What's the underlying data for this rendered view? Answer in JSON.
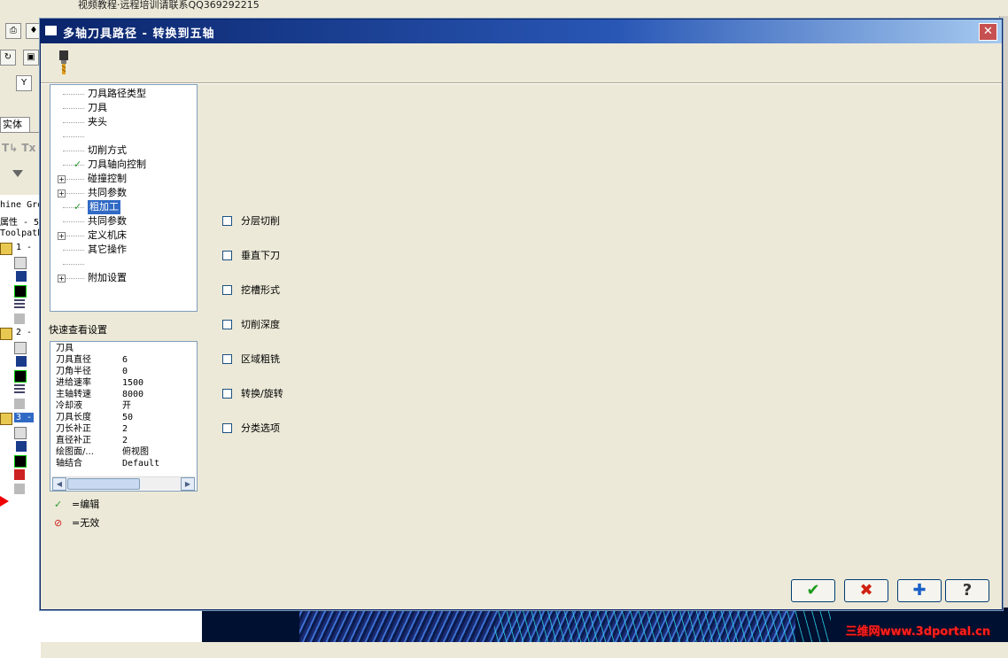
{
  "background": {
    "top_text": "视频教程·远程培训请联系QQ369292215",
    "left_tab": "实体",
    "left_lines": [
      "hine Gro",
      "属性 - 5",
      "Toolpath",
      "1 - ",
      "2 - ",
      "3 - "
    ],
    "watermark": "三维网www.3dportal.cn"
  },
  "dialog": {
    "title": "多轴刀具路径 - 转换到五轴",
    "close_label": "✕",
    "tree_items": [
      {
        "label": "刀具路径类型",
        "check": false,
        "expand": false
      },
      {
        "label": "刀具",
        "check": false,
        "expand": false
      },
      {
        "label": "夹头",
        "check": false,
        "expand": false
      },
      {
        "label": "",
        "check": false,
        "expand": false
      },
      {
        "label": "切削方式",
        "check": false,
        "expand": false
      },
      {
        "label": "刀具轴向控制",
        "check": true,
        "expand": false
      },
      {
        "label": "碰撞控制",
        "check": false,
        "expand": true
      },
      {
        "label": "共同参数",
        "check": false,
        "expand": true
      },
      {
        "label": "粗加工",
        "check": true,
        "expand": false,
        "selected": true
      },
      {
        "label": "共同参数",
        "check": false,
        "expand": false
      },
      {
        "label": "定义机床",
        "check": false,
        "expand": true
      },
      {
        "label": "其它操作",
        "check": false,
        "expand": false
      },
      {
        "label": "",
        "check": false,
        "expand": false
      },
      {
        "label": "附加设置",
        "check": false,
        "expand": true
      }
    ],
    "quick_view_label": "快速查看设置",
    "quick_view": [
      {
        "k": "刀具",
        "v": ""
      },
      {
        "k": "刀具直径",
        "v": "6"
      },
      {
        "k": "刀角半径",
        "v": "0"
      },
      {
        "k": "进给速率",
        "v": "1500"
      },
      {
        "k": "主轴转速",
        "v": "8000"
      },
      {
        "k": "冷却液",
        "v": "开"
      },
      {
        "k": "刀具长度",
        "v": "50"
      },
      {
        "k": "刀长补正",
        "v": "2"
      },
      {
        "k": "直径补正",
        "v": "2"
      },
      {
        "k": "绘图面/...",
        "v": "俯视图"
      },
      {
        "k": "轴结合",
        "v": "Default"
      }
    ],
    "legend": [
      {
        "symbol": "✓",
        "label": "=编辑",
        "color": "#2a9a2a"
      },
      {
        "symbol": "⊘",
        "label": "=无效",
        "color": "#d02020"
      }
    ],
    "options": [
      {
        "label": "分层切削",
        "checked": false
      },
      {
        "label": "垂直下刀",
        "checked": false
      },
      {
        "label": "挖槽形式",
        "checked": false
      },
      {
        "label": "切削深度",
        "checked": false
      },
      {
        "label": "区域粗铣",
        "checked": false
      },
      {
        "label": "转换/旋转",
        "checked": false
      },
      {
        "label": "分类选项",
        "checked": false
      }
    ],
    "buttons": [
      {
        "name": "ok-button",
        "icon": "✔",
        "color": "#1a9a1a"
      },
      {
        "name": "cancel-button",
        "icon": "✖",
        "color": "#d02010"
      },
      {
        "name": "add-button",
        "icon": "✚",
        "color": "#1a60c8"
      },
      {
        "name": "help-button",
        "icon": "?",
        "color": "#333333"
      }
    ]
  }
}
